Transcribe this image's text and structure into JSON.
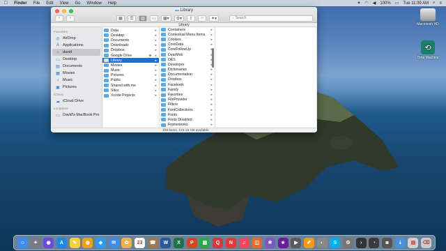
{
  "menubar": {
    "apple": "",
    "items": [
      "Finder",
      "File",
      "Edit",
      "View",
      "Go",
      "Window",
      "Help"
    ],
    "battery": "100%",
    "clock": "Tue 11:39 AM"
  },
  "window": {
    "title": "Library",
    "path": "Library",
    "search_placeholder": "Search",
    "status": "108 items, 172.16 GB available"
  },
  "sidebar": {
    "favorites_header": "Favorites",
    "favorites": [
      {
        "label": "AirDrop",
        "icon": "airdrop-icon",
        "glyph": "◎"
      },
      {
        "label": "Applications",
        "icon": "applications-icon",
        "glyph": "A"
      },
      {
        "label": "david",
        "icon": "home-icon",
        "glyph": "⌂"
      },
      {
        "label": "Desktop",
        "icon": "desktop-icon",
        "glyph": "▭"
      },
      {
        "label": "Documents",
        "icon": "documents-icon",
        "glyph": "▤"
      },
      {
        "label": "Movies",
        "icon": "movies-icon",
        "glyph": "▦"
      },
      {
        "label": "Music",
        "icon": "music-icon",
        "glyph": "♪"
      },
      {
        "label": "Pictures",
        "icon": "pictures-icon",
        "glyph": "▣"
      }
    ],
    "icloud_header": "iCloud",
    "icloud": [
      {
        "label": "iCloud Drive",
        "icon": "cloud-icon",
        "glyph": "☁"
      }
    ],
    "locations_header": "Locations",
    "locations": [
      {
        "label": "David's MacBook Pro",
        "icon": "laptop-icon",
        "glyph": "▭"
      }
    ]
  },
  "column1": [
    "Data",
    "Desktop",
    "Documents",
    "Downloads",
    "Dropbox",
    "Google Drive",
    "Library",
    "Movies",
    "Music",
    "Pictures",
    "Public",
    "Shared with me",
    "Sites",
    "Xcode Projects"
  ],
  "column2": [
    "Containers",
    "Contextual Menu Items",
    "Cookies",
    "CoreData",
    "CoreFollowUp",
    "DearMob",
    "DES",
    "Developer",
    "Dictionaries",
    "Documentation",
    "Dropbox",
    "Facebook",
    "Family",
    "Favorites",
    "FileProvider",
    "Filters",
    "FontCollections",
    "Fonts",
    "Fonts Disabled",
    "Frameworks"
  ],
  "desktop": {
    "disk_label": "Macintosh HD",
    "tm_label": "Time Machine"
  },
  "dock": [
    {
      "icon": "finder-icon",
      "color": "#3d8cf0",
      "glyph": "☺"
    },
    {
      "icon": "launchpad-icon",
      "color": "#7a7a86",
      "glyph": "✦"
    },
    {
      "icon": "siri-icon",
      "color": "#6b4bd8",
      "glyph": "◉"
    },
    {
      "icon": "app-store-icon",
      "color": "#1e88e5",
      "glyph": "A"
    },
    {
      "icon": "notes-icon",
      "color": "#f4d03f",
      "glyph": "✎"
    },
    {
      "icon": "chrome-icon",
      "color": "#e8a317",
      "glyph": "◍"
    },
    {
      "icon": "safari-icon",
      "color": "#2b9af3",
      "glyph": "◈"
    },
    {
      "icon": "mail-icon",
      "color": "#3a8de8",
      "glyph": "✉"
    },
    {
      "icon": "photos-icon",
      "color": "#e9b44c",
      "glyph": "✿"
    },
    {
      "icon": "calendar-icon",
      "color": "#ffffff",
      "glyph": "23"
    },
    {
      "icon": "contacts-icon",
      "color": "#a07850",
      "glyph": "☎"
    },
    {
      "icon": "word-icon",
      "color": "#2b579a",
      "glyph": "W"
    },
    {
      "icon": "excel-icon",
      "color": "#217346",
      "glyph": "X"
    },
    {
      "icon": "powerpoint-icon",
      "color": "#d24726",
      "glyph": "P"
    },
    {
      "icon": "numbers-icon",
      "color": "#2ca54b",
      "glyph": "▥"
    },
    {
      "icon": "quicktime-icon",
      "color": "#d23c3c",
      "glyph": "Q"
    },
    {
      "icon": "news-icon",
      "color": "#e53935",
      "glyph": "N"
    },
    {
      "icon": "music-icon",
      "color": "#f0455d",
      "glyph": "♫"
    },
    {
      "icon": "keynote-icon",
      "color": "#e36b2c",
      "glyph": "◫"
    },
    {
      "icon": "messages-icon",
      "color": "#7e57c2",
      "glyph": "✱"
    },
    {
      "icon": "imovie-icon",
      "color": "#6a1b9a",
      "glyph": "★"
    },
    {
      "icon": "screenflow-icon",
      "color": "#5b5b5b",
      "glyph": "▶"
    },
    {
      "icon": "pages-icon",
      "color": "#f39c12",
      "glyph": "✐"
    },
    {
      "icon": "preview-icon",
      "color": "#888888",
      "glyph": "◐"
    },
    {
      "icon": "skype-icon",
      "color": "#00aff0",
      "glyph": "S"
    },
    {
      "icon": "system-preferences-icon",
      "color": "#777777",
      "glyph": "⚙"
    },
    {
      "icon": "terminal-icon",
      "color": "#333333",
      "glyph": "›"
    },
    {
      "icon": "activity-monitor-icon",
      "color": "#3a3a3a",
      "glyph": "◔"
    },
    {
      "icon": "screenshot-icon",
      "color": "#555555",
      "glyph": "◙"
    },
    {
      "icon": "downloads-icon",
      "color": "#4a90d9",
      "glyph": "⇣"
    },
    {
      "icon": "documents-stack-icon",
      "color": "#d0d0d0",
      "glyph": "▤"
    },
    {
      "icon": "trash-icon",
      "color": "#c7ccd3",
      "glyph": "⌫"
    }
  ]
}
